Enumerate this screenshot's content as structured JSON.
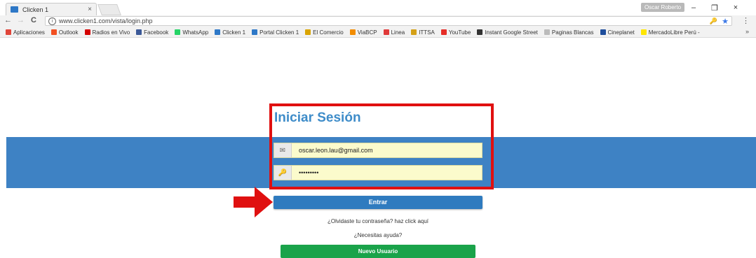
{
  "browser": {
    "tab_title": "Clicken 1",
    "tab_close": "×",
    "profile_name": "Oscar Roberto",
    "window_minimize": "–",
    "window_restore": "❐",
    "window_close": "×",
    "url": "www.clicken1.com/vista/login.php",
    "back": "←",
    "forward": "→",
    "reload": "C",
    "menu": "⋮",
    "bookmarks_more": "»",
    "bookmarks": [
      {
        "label": "Aplicaciones",
        "icon": "apps-grid-icon",
        "color": "#e0463a"
      },
      {
        "label": "Outlook",
        "icon": "windows-logo-icon",
        "color": "#f25022"
      },
      {
        "label": "Radios en Vivo",
        "icon": "flag-peru-icon",
        "color": "#d40000"
      },
      {
        "label": "Facebook",
        "icon": "facebook-icon",
        "color": "#3b5998"
      },
      {
        "label": "WhatsApp",
        "icon": "whatsapp-icon",
        "color": "#25d366"
      },
      {
        "label": "Clicken 1",
        "icon": "clicken-icon",
        "color": "#2e78c7"
      },
      {
        "label": "Portal Clicken 1",
        "icon": "clicken-icon",
        "color": "#2e78c7"
      },
      {
        "label": "El Comercio",
        "icon": "elcomercio-icon",
        "color": "#d9a400"
      },
      {
        "label": "ViaBCP",
        "icon": "bcp-icon",
        "color": "#f28c00"
      },
      {
        "label": "Linea",
        "icon": "linea-icon",
        "color": "#e03a3a"
      },
      {
        "label": "ITTSA",
        "icon": "ittsa-icon",
        "color": "#d4a017"
      },
      {
        "label": "YouTube",
        "icon": "youtube-icon",
        "color": "#e52d27"
      },
      {
        "label": "Instant Google Street",
        "icon": "street-icon",
        "color": "#333333"
      },
      {
        "label": "Paginas Blancas",
        "icon": "page-icon",
        "color": "#bbbbbb"
      },
      {
        "label": "Cineplanet",
        "icon": "cineplanet-icon",
        "color": "#1f4e9c"
      },
      {
        "label": "MercadoLibre Perú -",
        "icon": "mercadolibre-icon",
        "color": "#ffe600"
      }
    ]
  },
  "login": {
    "title": "Iniciar Sesión",
    "email_value": "oscar.leon.lau@gmail.com",
    "email_icon": "envelope-icon",
    "password_value": "•••••••••",
    "password_icon": "key-icon",
    "submit_label": "Entrar",
    "forgot_text": "¿Olvidaste tu contraseña? haz click aquí",
    "help_text": "¿Necesitas ayuda?",
    "new_user_label": "Nuevo Usuario"
  },
  "colors": {
    "band": "#3e82c4",
    "title": "#3e8cc9",
    "submit": "#2f7bbf",
    "new_user": "#1aa34a",
    "highlight": "#e01010",
    "field_bg": "#fbfbcc"
  }
}
